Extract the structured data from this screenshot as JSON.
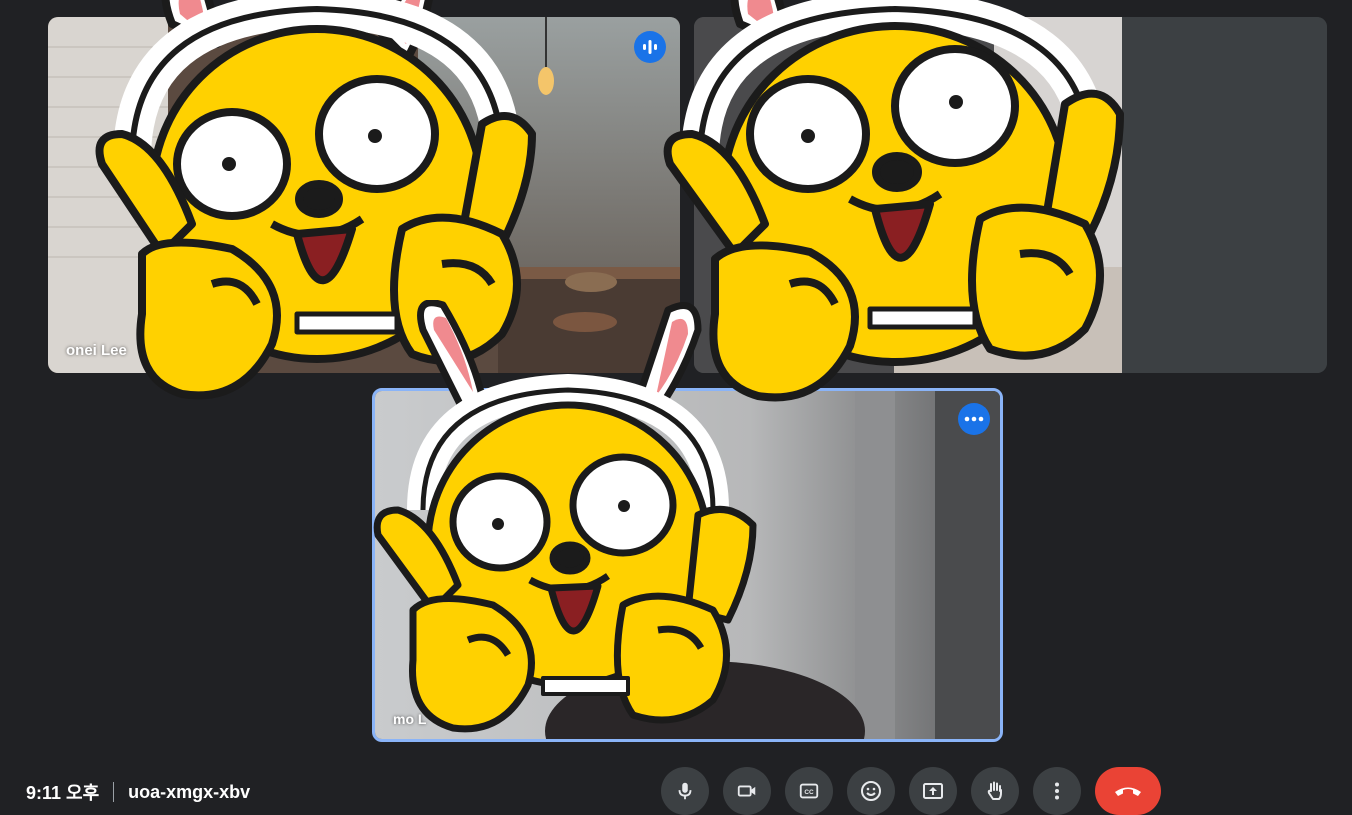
{
  "participants": [
    {
      "name": "onei Lee",
      "speaking": true
    },
    {
      "name": ""
    },
    {
      "name": "mo L",
      "menu": "more-options"
    }
  ],
  "meeting": {
    "time": "9:11 오후",
    "code": "uoa-xmgx-xbv"
  },
  "controls": [
    {
      "name": "microphone",
      "icon": "mic-icon"
    },
    {
      "name": "camera",
      "icon": "videocam-icon"
    },
    {
      "name": "captions",
      "icon": "closed-captions-icon"
    },
    {
      "name": "reactions",
      "icon": "emoji-icon"
    },
    {
      "name": "present",
      "icon": "present-screen-icon"
    },
    {
      "name": "raise-hand",
      "icon": "hand-icon"
    },
    {
      "name": "more-options",
      "icon": "more-vert-icon"
    },
    {
      "name": "leave-call",
      "icon": "call-end-icon"
    }
  ],
  "colors": {
    "background": "#202124",
    "control": "#3c4043",
    "accent": "#1a73e8",
    "end_call": "#ea4335",
    "active_border": "#8ab4f8"
  }
}
